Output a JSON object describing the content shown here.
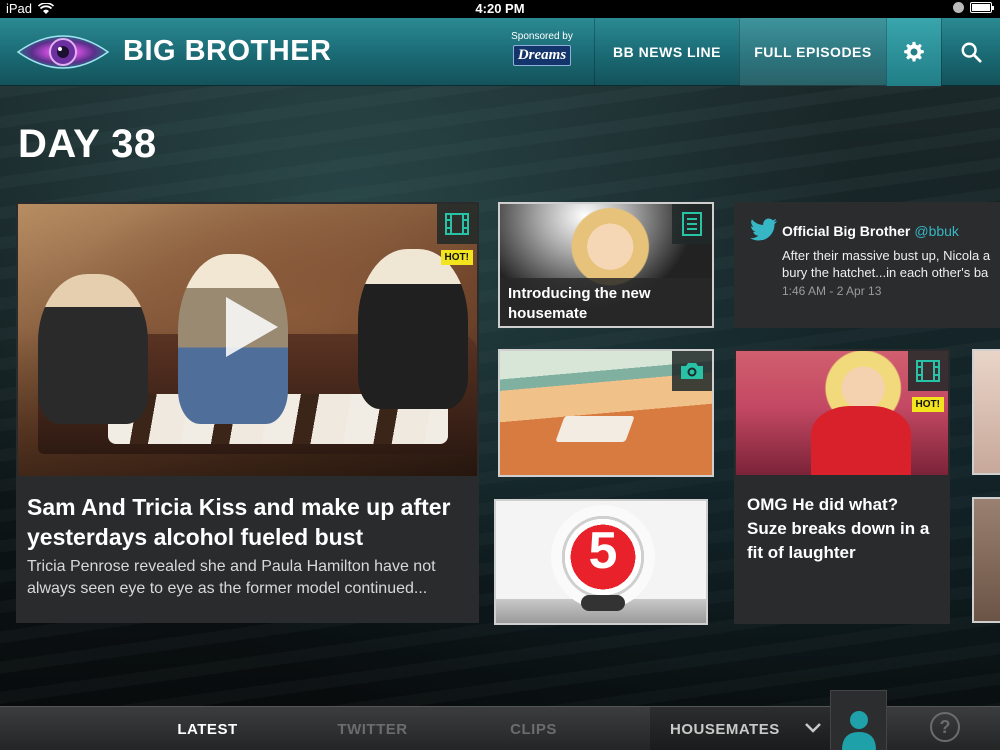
{
  "status_bar": {
    "device": "iPad",
    "time": "4:20 PM"
  },
  "header": {
    "brand": "BIG BROTHER",
    "sponsor_label": "Sponsored by",
    "sponsor_name": "Dreams",
    "nav": [
      "BB NEWS LINE",
      "FULL EPISODES"
    ]
  },
  "page": {
    "day_title": "DAY 38"
  },
  "feature": {
    "title": "Sam And Tricia Kiss and make up after yesterdays alcohol fueled bust",
    "subtitle": "Tricia Penrose revealed she and Paula Hamilton have not always seen eye to eye as the former model continued...",
    "hot_label": "HOT!"
  },
  "intro_card": {
    "caption": "Introducing the new housemate"
  },
  "tweet": {
    "author": "Official Big Brother",
    "handle": "@bbuk",
    "text_line1": "After their massive bust up, Nicola a",
    "text_line2": "bury the hatchet...in each other's ba",
    "timestamp": "1:46 AM - 2 Apr 13"
  },
  "suze_card": {
    "caption": "OMG He did what? Suze breaks down in a fit of laughter",
    "hot_label": "HOT!"
  },
  "channel_card": {
    "logo_text": "5"
  },
  "tabs": {
    "latest": "LATEST",
    "twitter": "TWITTER",
    "clips": "CLIPS",
    "housemates": "HOUSEMATES"
  },
  "help_label": "?",
  "colors": {
    "accent_teal": "#1fa1a9",
    "hot_yellow": "#f3e51d",
    "twitter_blue": "#37b6c6"
  }
}
